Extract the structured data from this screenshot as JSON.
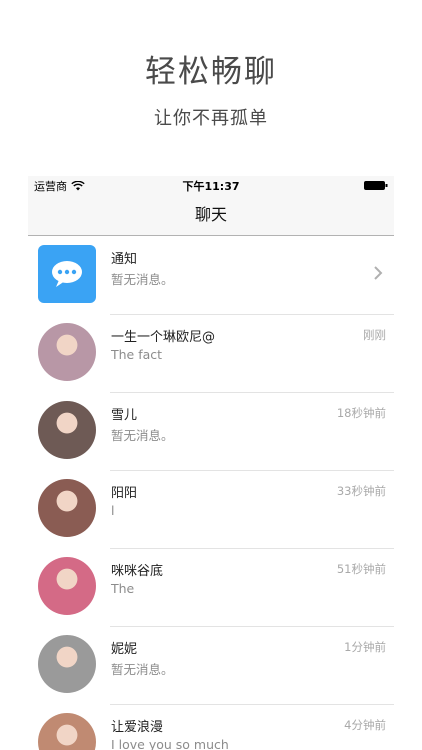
{
  "promo": {
    "title": "轻松畅聊",
    "subtitle": "让你不再孤单"
  },
  "status_bar": {
    "carrier": "运营商",
    "time": "下午11:37"
  },
  "nav": {
    "title": "聊天"
  },
  "notification": {
    "title": "通知",
    "preview": "暂无消息。",
    "icon": "chat-bubble-icon",
    "accent": "#3aa3f4"
  },
  "conversations": [
    {
      "name": "一生一个琳欧尼@",
      "preview": "The fact",
      "time": "刚刚",
      "avatar_color": "#b897a6"
    },
    {
      "name": "雪儿",
      "preview": "暂无消息。",
      "time": "18秒钟前",
      "avatar_color": "#6e5a55"
    },
    {
      "name": "阳阳",
      "preview": "l",
      "time": "33秒钟前",
      "avatar_color": "#8a5c53"
    },
    {
      "name": "咪咪谷底",
      "preview": "The",
      "time": "51秒钟前",
      "avatar_color": "#d46a86"
    },
    {
      "name": "妮妮",
      "preview": "暂无消息。",
      "time": "1分钟前",
      "avatar_color": "#9a9a9a"
    },
    {
      "name": "让爱浪漫",
      "preview": "I love you so much",
      "time": "4分钟前",
      "avatar_color": "#c08a72"
    }
  ]
}
